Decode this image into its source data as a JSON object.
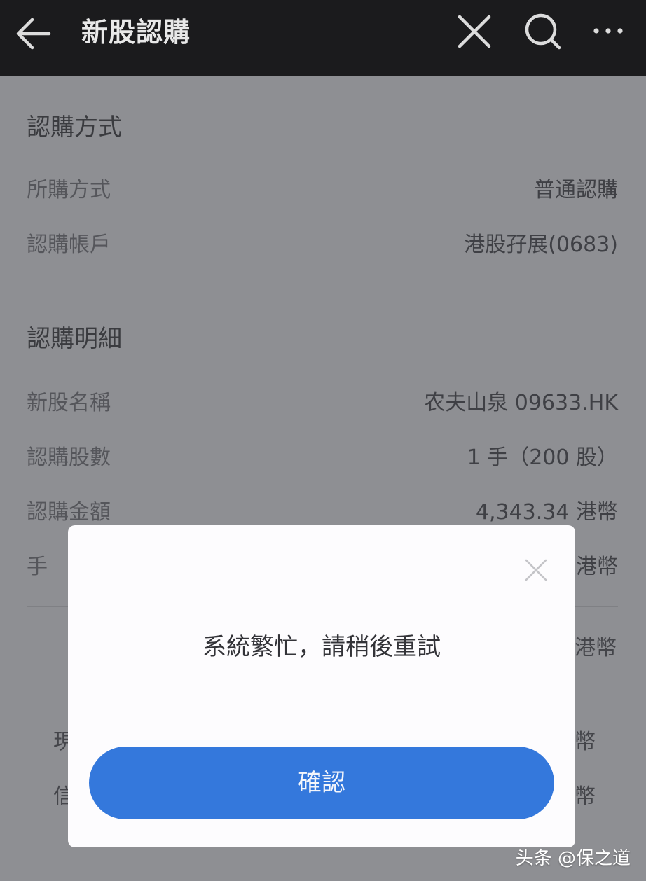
{
  "header": {
    "title": "新股認購",
    "back_icon": "arrow-left-icon",
    "close_icon": "close-icon",
    "search_icon": "search-icon",
    "more_icon": "more-horizontal-icon"
  },
  "subscription_method": {
    "section_title": "認購方式",
    "rows": [
      {
        "label": "所購方式",
        "value": "普通認購"
      },
      {
        "label": "認購帳戶",
        "value": "港股孖展(0683)"
      }
    ]
  },
  "subscription_details": {
    "section_title": "認購明細",
    "rows": [
      {
        "label": "新股名稱",
        "value": "农夫山泉 09633.HK"
      },
      {
        "label": "認購股數",
        "value": "1 手（200 股）"
      },
      {
        "label": "認購金額",
        "value": "4,343.34 港幣"
      },
      {
        "label": "手",
        "value": "港幣"
      }
    ],
    "peek_texts": [
      "港幣",
      "幣",
      "幣"
    ],
    "peek_left_texts": [
      "現",
      "信"
    ]
  },
  "dialog": {
    "message": "系統繁忙，請稍後重試",
    "confirm_label": "確認",
    "close_icon": "close-icon"
  },
  "watermark": "头条 @保之道",
  "colors": {
    "topbar": "#1b1b1d",
    "overlay_background": "#8e8f93",
    "button": "#3478dc",
    "dialog_background": "#fdfcfe"
  }
}
